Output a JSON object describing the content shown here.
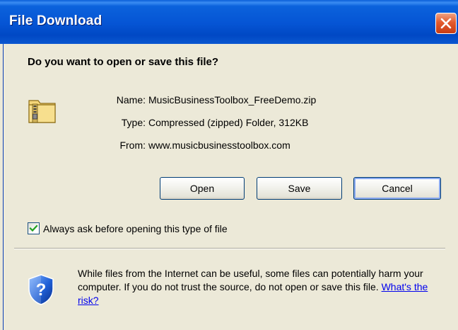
{
  "window": {
    "title": "File Download"
  },
  "dialog": {
    "question": "Do you want to open or save this file?",
    "file": {
      "name_label": "Name:",
      "name_value": "MusicBusinessToolbox_FreeDemo.zip",
      "type_label": "Type:",
      "type_value": "Compressed (zipped) Folder, 312KB",
      "from_label": "From:",
      "from_value": "www.musicbusinesstoolbox.com"
    },
    "buttons": {
      "open": "Open",
      "save": "Save",
      "cancel": "Cancel"
    },
    "always_ask": {
      "checked": true,
      "label": "Always ask before opening this type of file"
    },
    "warning": {
      "text": "While files from the Internet can be useful, some files can potentially harm your computer. If you do not trust the source, do not open or save this file.",
      "link": "What's the risk?"
    }
  },
  "icons": {
    "file": "zip-folder-icon",
    "security": "shield-question-icon",
    "close": "close-icon",
    "check": "checkmark-icon"
  },
  "colors": {
    "titlebar": "#0554d4",
    "dialog_bg": "#ece9d8",
    "link": "#0000ee",
    "close_button": "#e35a2d"
  }
}
